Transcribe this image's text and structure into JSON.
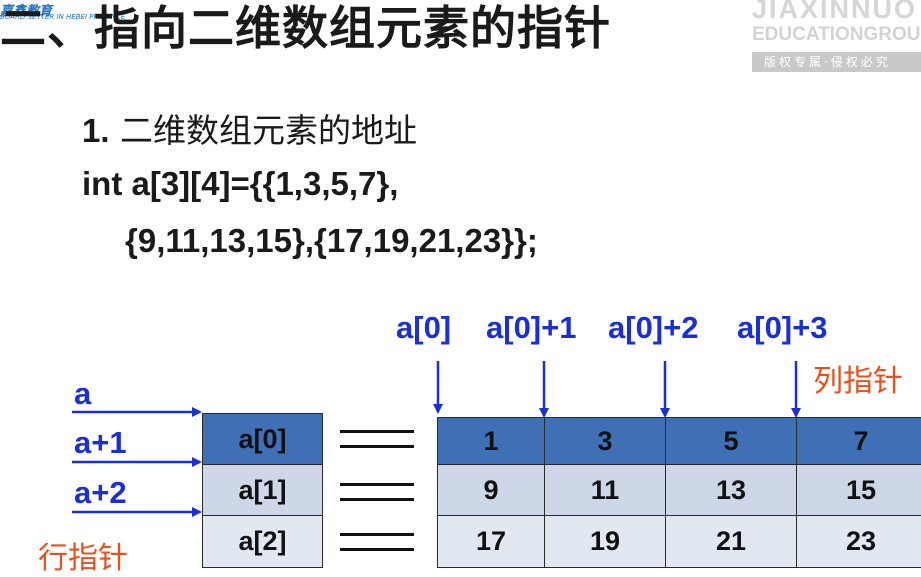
{
  "title": "二、指向二维数组元素的指针",
  "watermark": {
    "logo_text": "嘉鑫教育",
    "logo_sub": "BOARD SETTER IN HEBEI PROVINCE",
    "brand_line1": "JIAXINNUO",
    "brand_line2": "EDUCATIONGROUP",
    "notice": "版权专属·侵权必究"
  },
  "subtitle": {
    "number": "1.",
    "text": "二维数组元素的地址"
  },
  "code": {
    "line1": "int a[3][4]={{1,3,5,7},",
    "line2": "{9,11,13,15},{17,19,21,23}};"
  },
  "row_pointers": {
    "labels": [
      "a",
      "a+1",
      "a+2"
    ],
    "caption": "行指针"
  },
  "row_cells": [
    "a[0]",
    "a[1]",
    "a[2]"
  ],
  "col_pointers": {
    "labels": [
      "a[0]",
      "a[0]+1",
      "a[0]+2",
      "a[0]+3"
    ],
    "caption": "列指针"
  },
  "matrix": [
    [
      "1",
      "3",
      "5",
      "7"
    ],
    [
      "9",
      "11",
      "13",
      "15"
    ],
    [
      "17",
      "19",
      "21",
      "23"
    ]
  ],
  "colors": {
    "pointer_blue": "#1a2fd4",
    "caption_orange": "#e8511c",
    "header_row": "#3f6fb5",
    "body_row": "#cdd7e8"
  }
}
